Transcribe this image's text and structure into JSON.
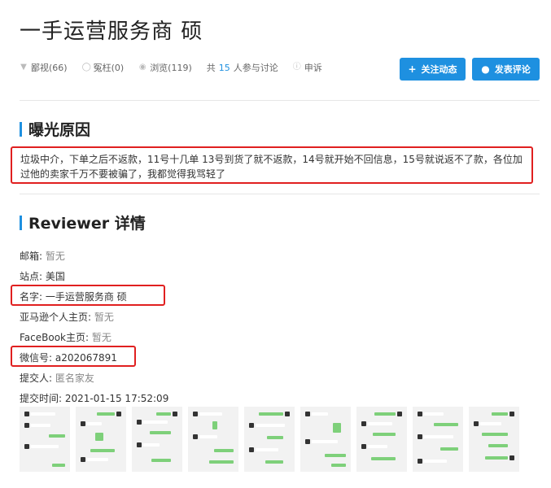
{
  "title": "一手运营服务商 硕",
  "meta": {
    "dislike": "鄙视(66)",
    "wrong": "冤枉(0)",
    "views": "浏览(119)",
    "discuss_prefix": "共",
    "discuss_count": "15",
    "discuss_suffix": "人参与讨论",
    "report": "申诉"
  },
  "buttons": {
    "follow": "关注动态",
    "comment": "发表评论"
  },
  "sections": {
    "reason_title": "曝光原因",
    "reviewer_title": "Reviewer 详情"
  },
  "reason_text": "垃圾中介，下单之后不返款，11号十几单 13号到货了就不返款，14号就开始不回信息，15号就说返不了款，各位加过他的卖家千万不要被骗了，我都觉得我骂轻了",
  "details": {
    "email_label": "邮箱:",
    "email": "暂无",
    "site_label": "站点:",
    "site": "美国",
    "name_label": "名字:",
    "name": "一手运营服务商 硕",
    "amazon_label": "亚马逊个人主页:",
    "amazon": "暂无",
    "facebook_label": "FaceBook主页:",
    "facebook": "暂无",
    "wechat_label": "微信号:",
    "wechat": "a202067891",
    "submitter_label": "提交人:",
    "submitter": "匿名家友",
    "time_label": "提交时间:",
    "time": "2021-01-15 17:52:09"
  },
  "colors": {
    "accent": "#1e90e0",
    "highlight_border": "#e02020"
  }
}
